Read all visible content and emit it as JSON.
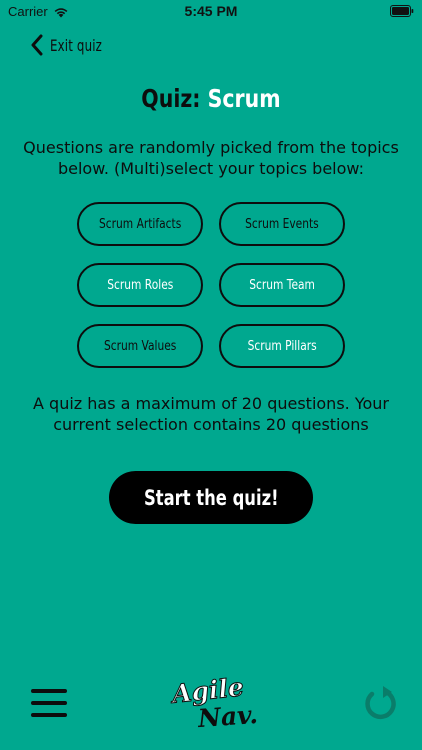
{
  "status_bar": {
    "carrier": "Carrier",
    "time": "5:45 PM"
  },
  "nav": {
    "back_label": "Exit quiz"
  },
  "title": {
    "prefix": "Quiz:",
    "topic": "Scrum"
  },
  "instructions": "Questions are randomly picked from the topics below. (Multi)select your topics below:",
  "topics": [
    {
      "label": "Scrum Artifacts",
      "selected": false
    },
    {
      "label": "Scrum Events",
      "selected": false
    },
    {
      "label": "Scrum Roles",
      "selected": true
    },
    {
      "label": "Scrum Team",
      "selected": true
    },
    {
      "label": "Scrum Values",
      "selected": false
    },
    {
      "label": "Scrum Pillars",
      "selected": true
    }
  ],
  "summary": "A quiz has a maximum of 20 questions. Your current selection contains 20 questions",
  "start_button_label": "Start the quiz!",
  "logo": {
    "line1": "Agile",
    "line2": "Nav."
  },
  "colors": {
    "background": "#00A88F",
    "selected_text": "#ffffff",
    "unselected_text": "#0d0d0d",
    "refresh_icon": "#0a7d6a"
  },
  "icons": {
    "back": "chevron-left-icon",
    "menu": "hamburger-menu-icon",
    "refresh": "refresh-icon",
    "wifi": "wifi-icon",
    "battery": "battery-icon"
  }
}
